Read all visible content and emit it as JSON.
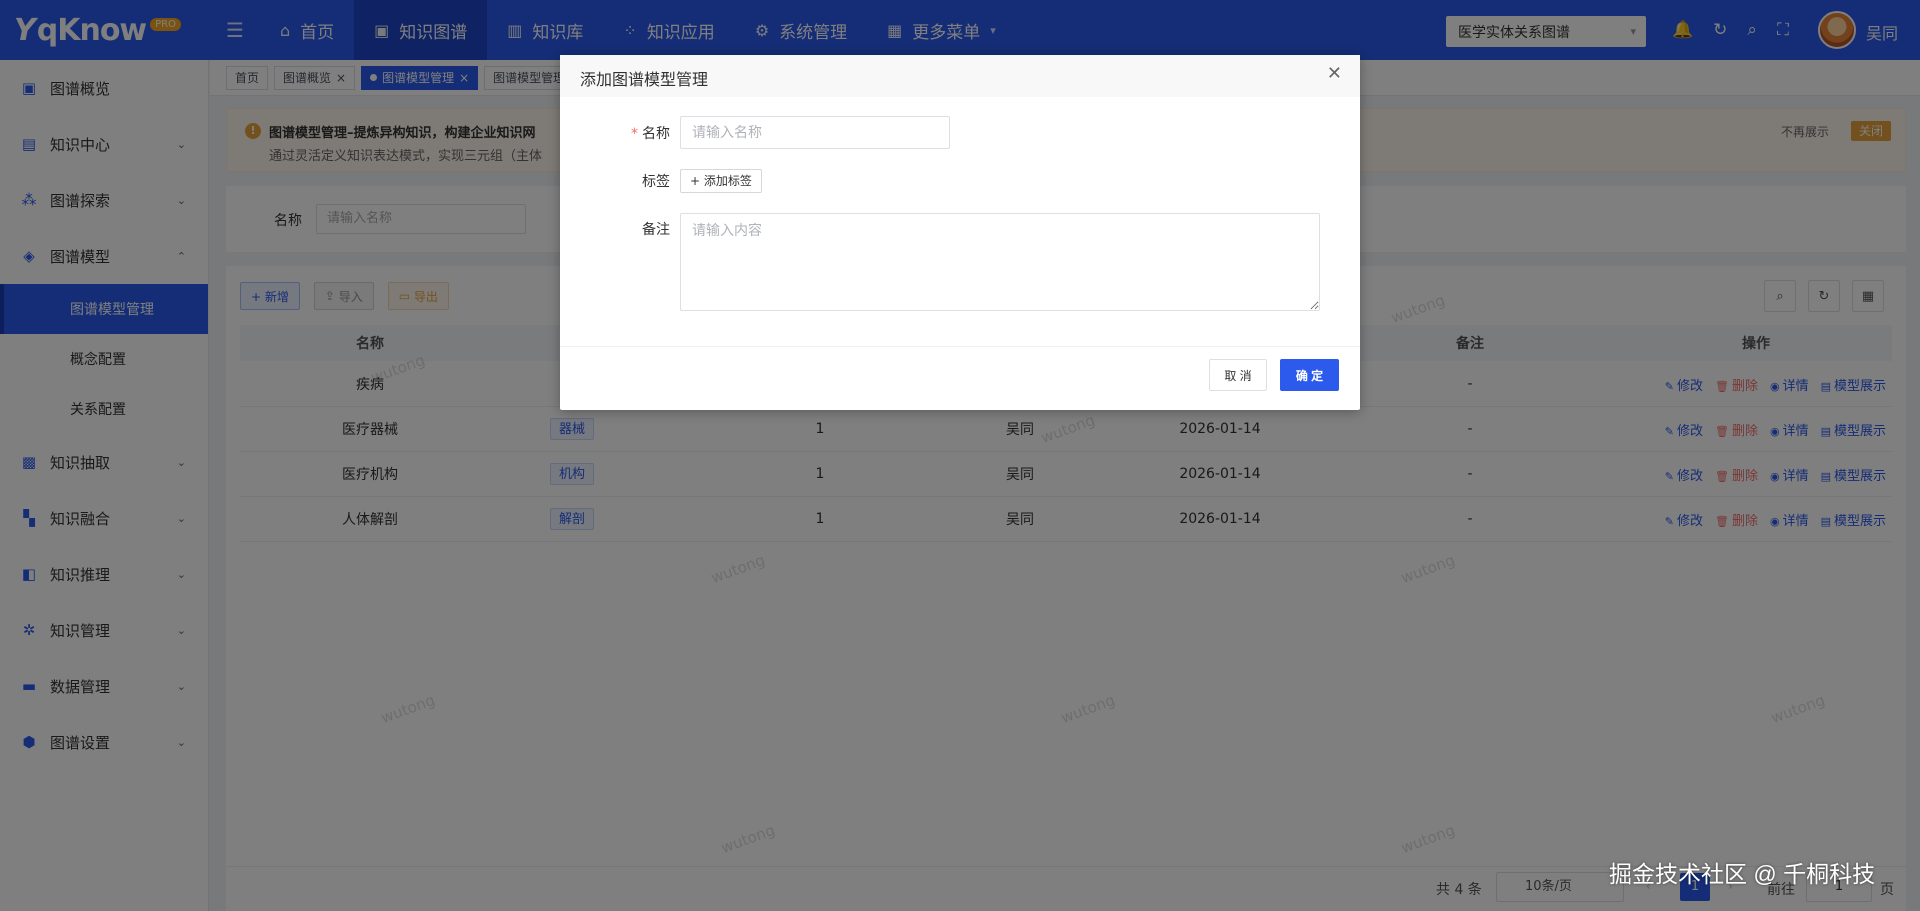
{
  "app": {
    "logo_text": "qKnow",
    "logo_badge": "PRO"
  },
  "topnav": [
    {
      "label": "首页",
      "icon": "home-icon"
    },
    {
      "label": "知识图谱",
      "icon": "book-icon",
      "active": true
    },
    {
      "label": "知识库",
      "icon": "library-icon"
    },
    {
      "label": "知识应用",
      "icon": "apps-icon"
    },
    {
      "label": "系统管理",
      "icon": "gear-icon"
    },
    {
      "label": "更多菜单",
      "icon": "grid-icon"
    }
  ],
  "graph_select": {
    "value": "医学实体关系图谱"
  },
  "user": {
    "name": "吴同"
  },
  "sidebar": {
    "items": [
      {
        "label": "图谱概览",
        "icon": "overview-icon"
      },
      {
        "label": "知识中心",
        "icon": "book-open-icon"
      },
      {
        "label": "图谱探索",
        "icon": "explore-icon"
      },
      {
        "label": "图谱模型",
        "icon": "cube-icon",
        "expanded": true
      },
      {
        "label": "知识抽取",
        "icon": "extract-icon"
      },
      {
        "label": "知识融合",
        "icon": "merge-icon"
      },
      {
        "label": "知识推理",
        "icon": "reason-icon"
      },
      {
        "label": "知识管理",
        "icon": "manage-icon"
      },
      {
        "label": "数据管理",
        "icon": "folder-icon"
      },
      {
        "label": "图谱设置",
        "icon": "settings-icon"
      }
    ],
    "sub_items": [
      "图谱模型管理",
      "概念配置",
      "关系配置"
    ]
  },
  "tabs": [
    "首页",
    "图谱概览",
    "图谱模型管理",
    "图谱模型管理"
  ],
  "alert": {
    "title": "图谱模型管理–提炼异构知识，构建企业知识网",
    "desc": "通过灵活定义知识表达模式，实现三元组（主体",
    "no_show": "不再展示",
    "close": "关闭"
  },
  "search": {
    "label": "名称",
    "placeholder": "请输入名称"
  },
  "toolbar": {
    "add": "+ 新增",
    "import": "导入",
    "export": "导出"
  },
  "table": {
    "headers": {
      "name": "名称",
      "remark": "备注",
      "ops": "操作"
    },
    "rows": [
      {
        "name": "疾病",
        "tag": "",
        "count": "",
        "creator": "",
        "date": "",
        "remark": "-"
      },
      {
        "name": "医疗器械",
        "tag": "器械",
        "count": "1",
        "creator": "吴同",
        "date": "2026-01-14",
        "remark": "-"
      },
      {
        "name": "医疗机构",
        "tag": "机构",
        "count": "1",
        "creator": "吴同",
        "date": "2026-01-14",
        "remark": "-"
      },
      {
        "name": "人体解剖",
        "tag": "解剖",
        "count": "1",
        "creator": "吴同",
        "date": "2026-01-14",
        "remark": "-"
      }
    ],
    "ops": {
      "edit": "修改",
      "delete": "删除",
      "detail": "详情",
      "show": "模型展示"
    }
  },
  "pager": {
    "total": "共 4 条",
    "page_size": "10条/页",
    "current": "1",
    "goto": "前往",
    "goto_value": "1",
    "page_suffix": "页"
  },
  "watermark_text": "wutong",
  "dialog": {
    "title": "添加图谱模型管理",
    "name_label": "名称",
    "name_placeholder": "请输入名称",
    "tag_label": "标签",
    "add_tag": "+ 添加标签",
    "remark_label": "备注",
    "remark_placeholder": "请输入内容",
    "cancel": "取 消",
    "ok": "确 定"
  },
  "source_watermark": "掘金技术社区 @ 千桐科技"
}
